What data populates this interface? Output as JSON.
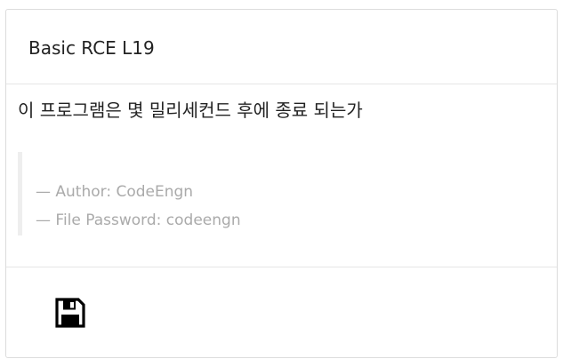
{
  "card": {
    "title": "Basic RCE L19",
    "question": "이 프로그램은 몇 밀리세컨드 후에 종료 되는가",
    "quote": {
      "author_line": "— Author: CodeEngn",
      "password_line": "— File Password: codeengn"
    },
    "footer": {
      "download_icon": "floppy-disk-icon"
    }
  },
  "colors": {
    "text": "#222222",
    "muted": "#aaaaaa",
    "border": "#dcdcdc",
    "quote_border": "#eeeeee"
  }
}
